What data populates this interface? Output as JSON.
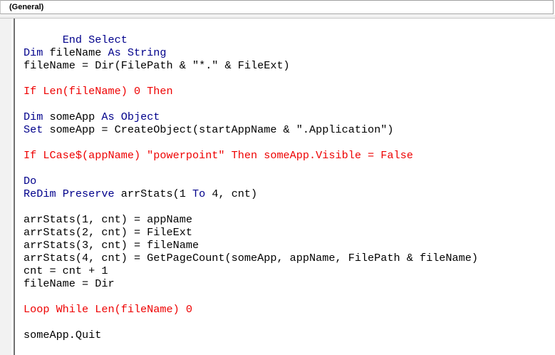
{
  "procedure_combo": {
    "value": "(General)"
  },
  "code": {
    "line_01": {
      "kw1": "End Select"
    },
    "line_02": {
      "kw1": "Dim",
      "t1": " fileName ",
      "kw2": "As",
      "t2": " ",
      "kw3": "String"
    },
    "line_03": {
      "text": "fileName = Dir(FilePath & \"*.\" & FileExt)"
    },
    "line_04": {
      "text": "If Len(fileName) 0 Then"
    },
    "line_05": {
      "kw1": "Dim",
      "t1": " someApp ",
      "kw2": "As",
      "t2": " ",
      "kw3": "Object"
    },
    "line_06": {
      "kw1": "Set",
      "t1": " someApp = CreateObject(startAppName & \".Application\")"
    },
    "line_07": {
      "text": "If LCase$(appName) \"powerpoint\" Then someApp.Visible = False"
    },
    "line_08": {
      "kw1": "Do"
    },
    "line_09": {
      "kw1": "ReDim",
      "t1": " ",
      "kw2": "Preserve",
      "t2": " arrStats(1 ",
      "kw3": "To",
      "t3": " 4, cnt)"
    },
    "line_10": {
      "text": "arrStats(1, cnt) = appName"
    },
    "line_11": {
      "text": "arrStats(2, cnt) = FileExt"
    },
    "line_12": {
      "text": "arrStats(3, cnt) = fileName"
    },
    "line_13": {
      "text": "arrStats(4, cnt) = GetPageCount(someApp, appName, FilePath & fileName)"
    },
    "line_14": {
      "text": "cnt = cnt + 1"
    },
    "line_15": {
      "text": "fileName = Dir"
    },
    "line_16": {
      "text": "Loop While Len(fileName) 0"
    },
    "line_17": {
      "text": "someApp.Quit"
    }
  }
}
